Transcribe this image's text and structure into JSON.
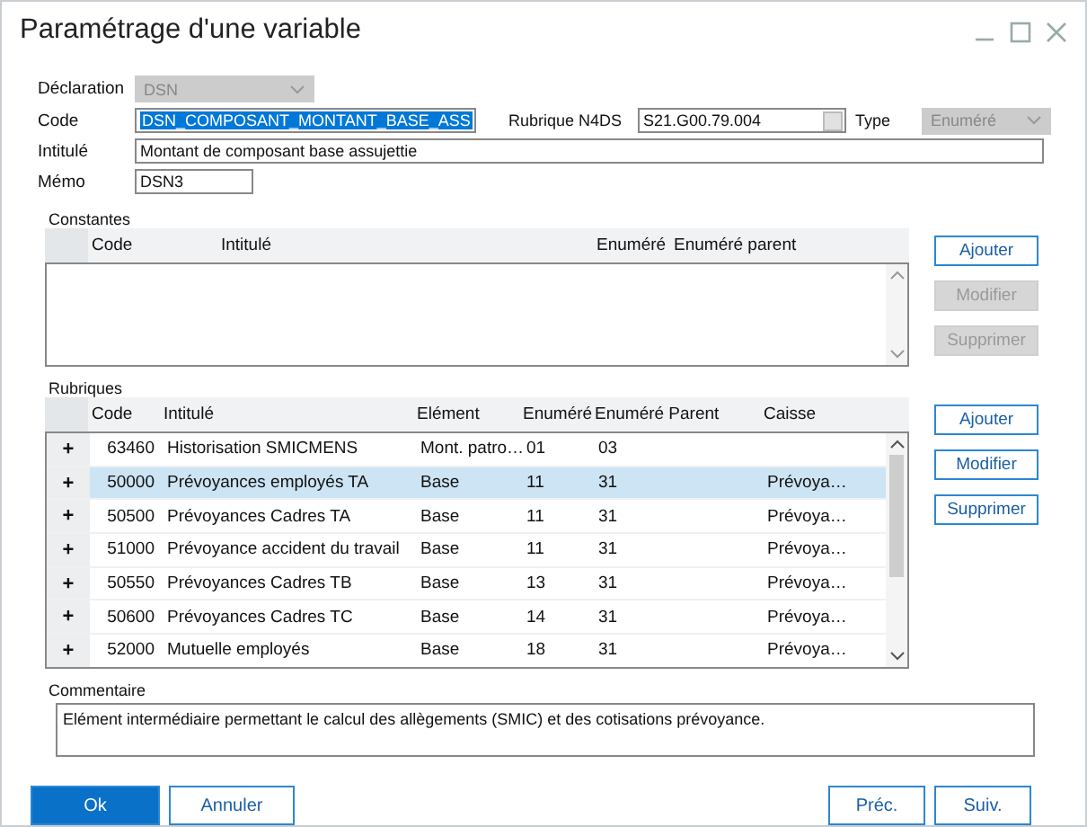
{
  "window": {
    "title": "Paramétrage d'une variable"
  },
  "form": {
    "declaration": {
      "label": "Déclaration",
      "value": "DSN",
      "disabled": true
    },
    "code": {
      "label": "Code",
      "value": "DSN_COMPOSANT_MONTANT_BASE_ASS",
      "selected": true
    },
    "rubrique_n4ds": {
      "label": "Rubrique N4DS",
      "value": "S21.G00.79.004"
    },
    "type": {
      "label": "Type",
      "value": "Enuméré",
      "disabled": true
    },
    "intitule": {
      "label": "Intitulé",
      "value": "Montant de composant base assujettie"
    },
    "memo": {
      "label": "Mémo",
      "value": "DSN3"
    }
  },
  "constantes": {
    "title": "Constantes",
    "columns": [
      "Code",
      "Intitulé",
      "Enuméré",
      "Enuméré parent"
    ],
    "buttons": [
      {
        "label": "Ajouter",
        "disabled": false
      },
      {
        "label": "Modifier",
        "disabled": true
      },
      {
        "label": "Supprimer",
        "disabled": true
      }
    ]
  },
  "rubriques": {
    "title": "Rubriques",
    "columns": [
      "Code",
      "Intitulé",
      "Elément",
      "Enuméré",
      "Enuméré Parent",
      "Caisse"
    ],
    "rows": [
      {
        "expander": "+",
        "selected": false,
        "cells": [
          "63460",
          "Historisation SMICMENS",
          "Mont. patro…",
          "01",
          "03",
          ""
        ]
      },
      {
        "expander": "+",
        "selected": true,
        "cells": [
          "50000",
          "Prévoyances employés TA",
          "Base",
          "11",
          "31",
          "Prévoya…"
        ]
      },
      {
        "expander": "+",
        "selected": false,
        "cells": [
          "50500",
          "Prévoyances Cadres TA",
          "Base",
          "11",
          "31",
          "Prévoya…"
        ]
      },
      {
        "expander": "+",
        "selected": false,
        "cells": [
          "51000",
          "Prévoyance accident du travail",
          "Base",
          "11",
          "31",
          "Prévoya…"
        ]
      },
      {
        "expander": "+",
        "selected": false,
        "cells": [
          "50550",
          "Prévoyances Cadres TB",
          "Base",
          "13",
          "31",
          "Prévoya…"
        ]
      },
      {
        "expander": "+",
        "selected": false,
        "cells": [
          "50600",
          "Prévoyances Cadres TC",
          "Base",
          "14",
          "31",
          "Prévoya…"
        ]
      },
      {
        "expander": "+",
        "selected": false,
        "cells": [
          "52000",
          "Mutuelle employés",
          "Base",
          "18",
          "31",
          "Prévoya…"
        ]
      }
    ],
    "buttons": [
      {
        "label": "Ajouter",
        "disabled": false
      },
      {
        "label": "Modifier",
        "disabled": false
      },
      {
        "label": "Supprimer",
        "disabled": false
      }
    ]
  },
  "commentaire": {
    "label": "Commentaire",
    "value": "Elément intermédiaire permettant le calcul des allègements (SMIC) et des cotisations prévoyance."
  },
  "footer": {
    "left": [
      {
        "label": "Ok",
        "kind": "primary"
      },
      {
        "label": "Annuler",
        "kind": "default"
      }
    ],
    "right": [
      {
        "label": "Préc."
      },
      {
        "label": "Suiv."
      }
    ]
  }
}
